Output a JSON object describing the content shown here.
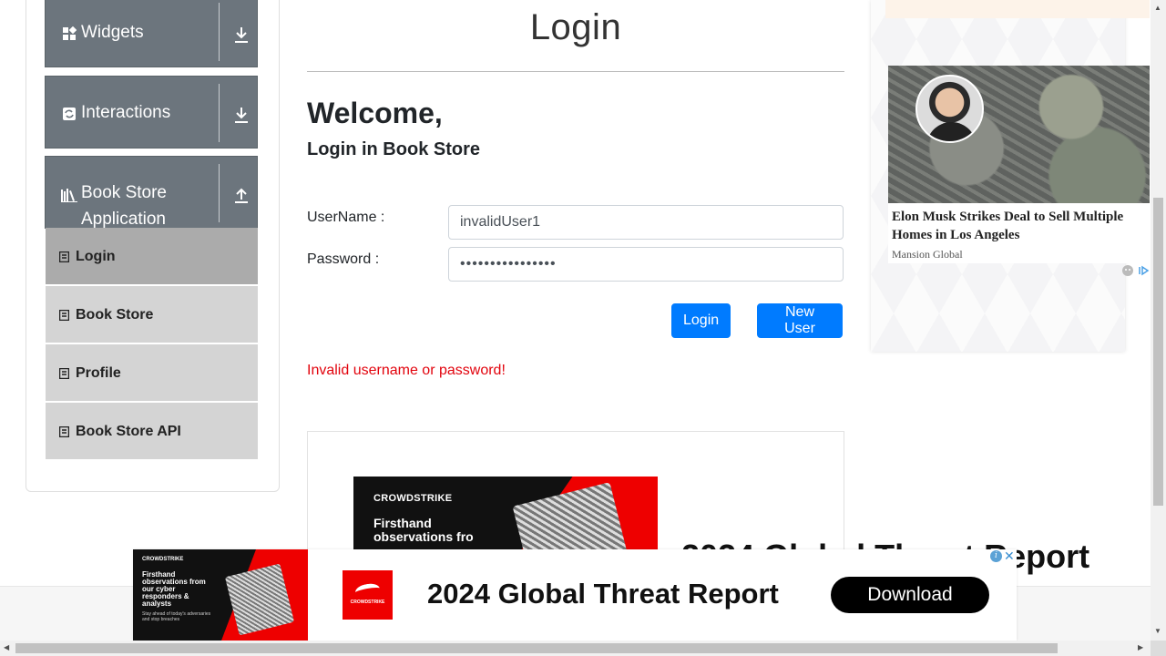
{
  "sidebar": {
    "groups": [
      {
        "label": "Widgets"
      },
      {
        "label": "Interactions"
      },
      {
        "label": "Book Store Application"
      }
    ],
    "items": [
      {
        "label": "Login"
      },
      {
        "label": "Book Store"
      },
      {
        "label": "Profile"
      },
      {
        "label": "Book Store API"
      }
    ]
  },
  "main": {
    "title": "Login",
    "welcome": "Welcome,",
    "subtitle": "Login in Book Store",
    "username_label": "UserName :",
    "username_value": "invalidUser1",
    "password_label": "Password :",
    "password_value": "••••••••••••••••",
    "login_button": "Login",
    "new_user_button": "New User",
    "error": "Invalid username or password!"
  },
  "promo": {
    "brand": "CROWDSTRIKE",
    "image_text": "Firsthand observations fro",
    "title": "2024 Global Threat Report"
  },
  "right_ad": {
    "headline": "Elon Musk Strikes Deal to Sell Multiple Homes in Los Angeles",
    "source": "Mansion Global"
  },
  "bottom_ad": {
    "brand": "CROWDSTRIKE",
    "image_text": "Firsthand observations from our cyber responders & analysts",
    "image_small": "Stay ahead of today's adversaries and stop breaches",
    "logo_text": "CROWDSTRIKE",
    "headline": "2024 Global Threat Report",
    "cta": "Download"
  },
  "colors": {
    "primary": "#007bff",
    "error": "#e2030d",
    "group_header": "#6c757d",
    "menu_item": "#d4d4d4",
    "menu_item_active": "#ababab"
  }
}
